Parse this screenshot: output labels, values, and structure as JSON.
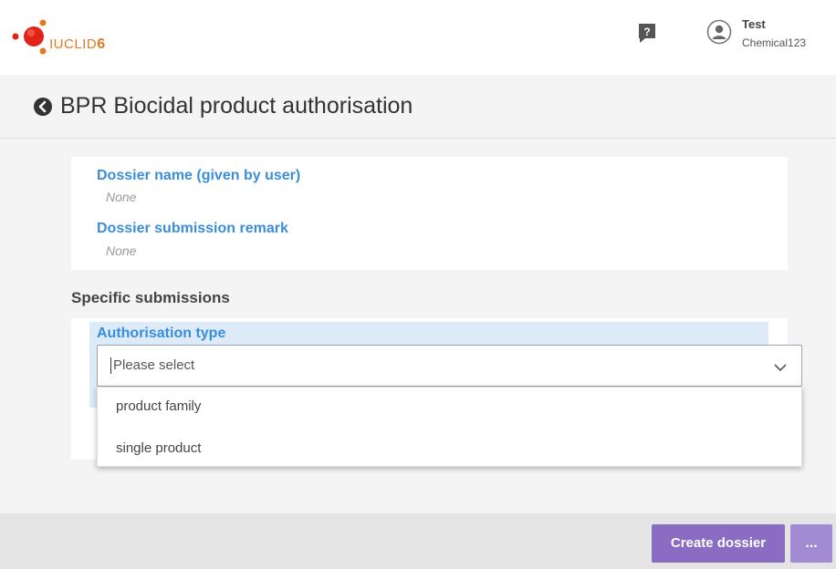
{
  "header": {
    "logo": {
      "brand": "IUCLID",
      "version": "6"
    },
    "help_icon": "question-icon",
    "user": {
      "name": "Test",
      "org": "Chemical123",
      "icon": "user-avatar-icon"
    }
  },
  "page": {
    "title": "BPR Biocidal product authorisation",
    "back_icon": "back-arrow-icon"
  },
  "dossier_info": {
    "fields": [
      {
        "label": "Dossier name (given by user)",
        "value": "None"
      },
      {
        "label": "Dossier submission remark",
        "value": "None"
      }
    ]
  },
  "specific_submissions": {
    "title": "Specific submissions",
    "authorisation_type": {
      "label": "Authorisation type",
      "placeholder": "Please select",
      "options": [
        "product family",
        "single product"
      ]
    }
  },
  "footer": {
    "create_label": "Create dossier",
    "more_label": "..."
  },
  "colors": {
    "accent": "#8a6cc3",
    "label_blue": "#3a8ed8",
    "brand_orange": "#e07b24"
  }
}
